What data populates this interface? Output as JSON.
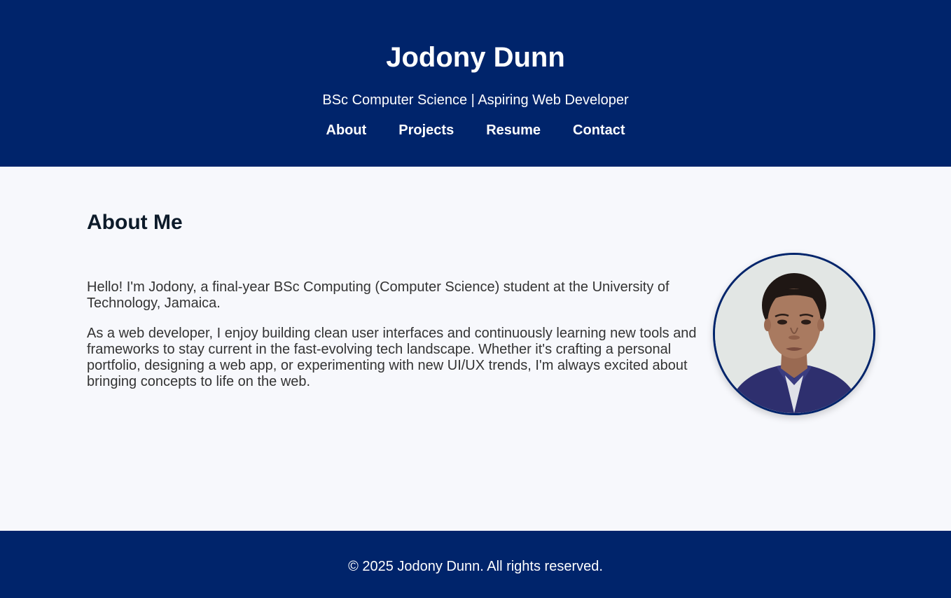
{
  "header": {
    "title": "Jodony Dunn",
    "subtitle": "BSc Computer Science | Aspiring Web Developer",
    "nav": [
      {
        "label": "About"
      },
      {
        "label": "Projects"
      },
      {
        "label": "Resume"
      },
      {
        "label": "Contact"
      }
    ]
  },
  "about": {
    "heading": "About Me",
    "paragraphs": [
      "Hello! I'm Jodony, a final-year BSc Computing (Computer Science) student at the University of Technology, Jamaica.",
      "As a web developer, I enjoy building clean user interfaces and continuously learning new tools and frameworks to stay current in the fast-evolving tech landscape. Whether it's crafting a personal portfolio, designing a web app, or experimenting with new UI/UX trends, I'm always excited about bringing concepts to life on the web."
    ]
  },
  "footer": {
    "copyright": "© 2025 Jodony Dunn. All rights reserved."
  },
  "colors": {
    "primary": "#00246b",
    "background": "#f7f8fc",
    "heading": "#0d1b2a",
    "body_text": "#333333"
  }
}
